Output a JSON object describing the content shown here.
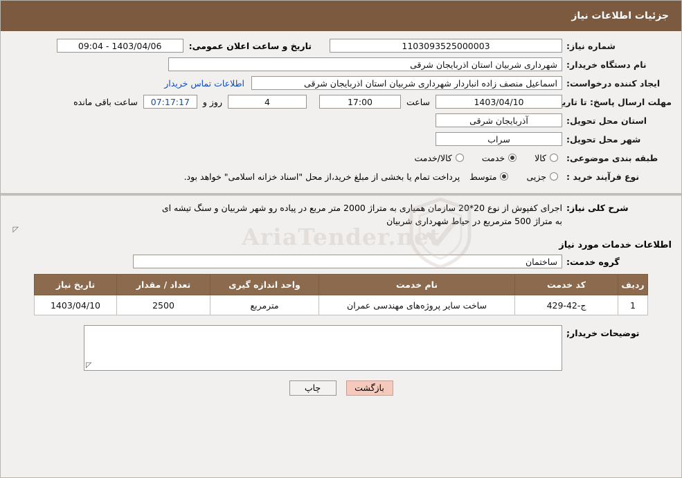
{
  "header": {
    "title": "جزئیات اطلاعات نیاز"
  },
  "form": {
    "need_number_label": "شماره نیاز:",
    "need_number_value": "1103093525000003",
    "public_announce_label": "تاریخ و ساعت اعلان عمومی:",
    "public_announce_value": "1403/04/06 - 09:04",
    "buyer_org_label": "نام دستگاه خریدار:",
    "buyer_org_value": "شهرداری شربیان استان اذربایجان شرقی",
    "requester_label": "ایجاد کننده درخواست:",
    "requester_value": "اسماعیل منصف زاده انباردار شهرداری شربیان استان اذربایجان شرقی",
    "contact_link": "اطلاعات تماس خریدار",
    "deadline_label": "مهلت ارسال پاسخ: تا تاریخ:",
    "deadline_date": "1403/04/10",
    "hour_label": "ساعت",
    "deadline_hour": "17:00",
    "days_value": "4",
    "days_label": "روز و",
    "remaining_value": "07:17:17",
    "remaining_label": "ساعت باقی مانده",
    "province_label": "استان محل تحویل:",
    "province_value": "آذربایجان شرقی",
    "city_label": "شهر محل تحویل:",
    "city_value": "سراب",
    "category_label": "طبقه بندی موضوعی:",
    "category_options": [
      {
        "label": "کالا",
        "checked": false
      },
      {
        "label": "خدمت",
        "checked": true
      },
      {
        "label": "کالا/خدمت",
        "checked": false
      }
    ],
    "purchase_type_label": "نوع فرآیند خرید :",
    "purchase_type_options": [
      {
        "label": "جزیی",
        "checked": false
      },
      {
        "label": "متوسط",
        "checked": true
      }
    ],
    "purchase_note": "پرداخت تمام یا بخشی از مبلغ خرید،از محل \"اسناد خزانه اسلامی\" خواهد بود."
  },
  "description": {
    "label": "شرح کلی نیاز:",
    "line1": "اجرای کفپوش از نوع 20*20 سازمان همیاری به متراژ 2000 متر مربع در پیاده رو شهر شربیان و سنگ تیشه ای",
    "line2": "به متراژ 500 مترمربع در حیاط شهرداری شربیان"
  },
  "services": {
    "section_title": "اطلاعات خدمات مورد نیاز",
    "group_label": "گروه خدمت:",
    "group_value": "ساختمان",
    "columns": [
      "ردیف",
      "کد خدمت",
      "نام خدمت",
      "واحد اندازه گیری",
      "تعداد / مقدار",
      "تاریخ نیاز"
    ],
    "rows": [
      {
        "index": "1",
        "code": "ج-42-429",
        "name": "ساخت سایر پروژه‌های مهندسی عمران",
        "unit": "مترمربع",
        "quantity": "2500",
        "date": "1403/04/10"
      }
    ]
  },
  "buyer_notes": {
    "label": "توضیحات خریدار;",
    "value": ""
  },
  "footer": {
    "print_label": "چاپ",
    "back_label": "بازگشت"
  },
  "watermark": {
    "text": "AriaTender.net"
  },
  "colors": {
    "header_bg": "#7b5a3f",
    "table_header_bg": "#8b6a4e",
    "link": "#0b4cc0",
    "back_button": "#f6c9bd"
  }
}
